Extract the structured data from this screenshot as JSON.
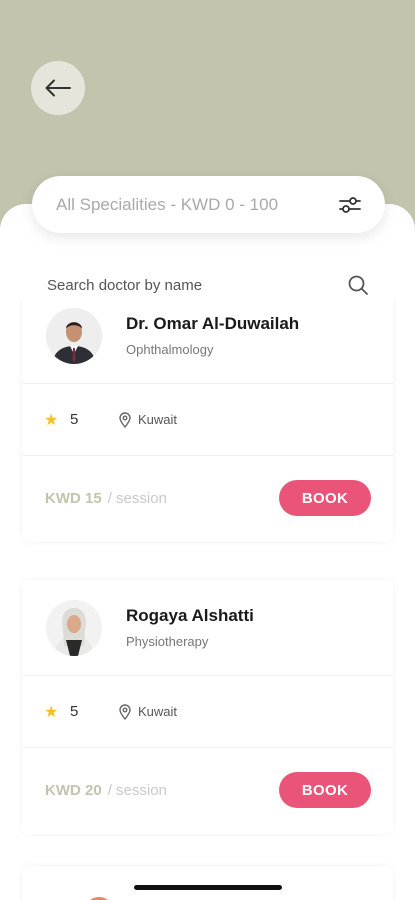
{
  "header": {
    "back_icon": "arrow-left-icon"
  },
  "filter": {
    "label": "All Specialities - KWD 0 - 100",
    "icon": "sliders-icon"
  },
  "search": {
    "placeholder": "Search doctor by name",
    "icon": "search-icon"
  },
  "doctors": [
    {
      "name": "Dr. Omar Al-Duwailah",
      "specialty": "Ophthalmology",
      "rating": "5",
      "location": "Kuwait",
      "price": "KWD 15",
      "per": "/ session",
      "book_label": "BOOK"
    },
    {
      "name": "Rogaya Alshatti",
      "specialty": "Physiotherapy",
      "rating": "5",
      "location": "Kuwait",
      "price": "KWD 20",
      "per": "/ session",
      "book_label": "BOOK"
    }
  ],
  "colors": {
    "header_bg": "#c3c4ad",
    "accent": "#ea5479",
    "star": "#f5c022"
  }
}
